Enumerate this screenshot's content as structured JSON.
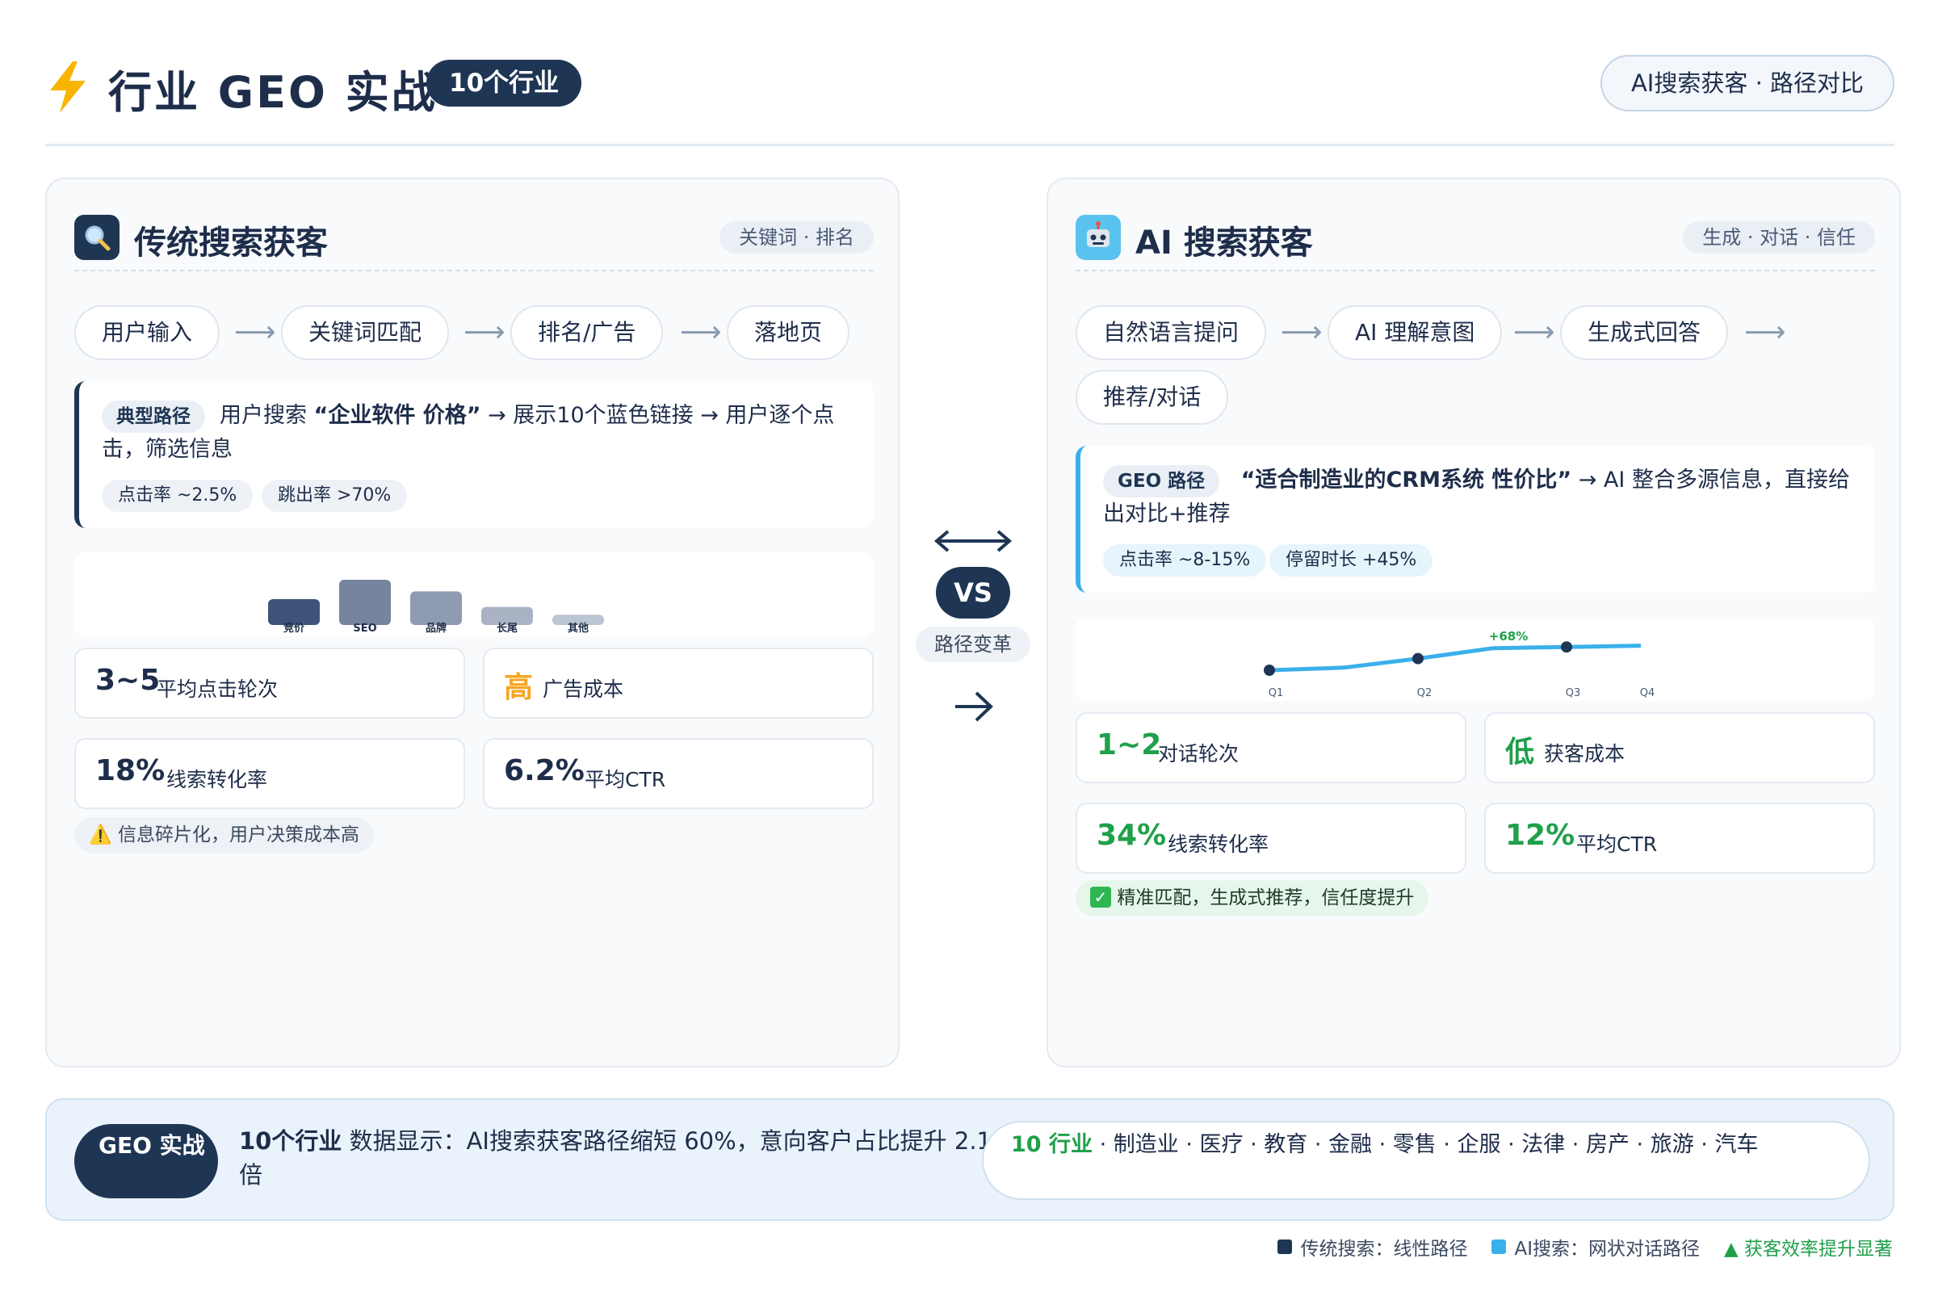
{
  "header": {
    "title": "行业 GEO 实战",
    "badge": "10个行业",
    "subtitle": "AI搜索获客 · 路径对比"
  },
  "colors": {
    "navy": "#1f3554",
    "ai_blue": "#3ab0ea",
    "green": "#1fa04a",
    "orange": "#f5a623"
  },
  "left": {
    "icon": "magnifier-icon",
    "title": "传统搜索获客",
    "tag": "关键词 · 排名",
    "steps": [
      "用户输入",
      "关键词匹配",
      "排名/广告",
      "落地页"
    ],
    "path_label": "典型路径",
    "path_prefix": "用户搜索",
    "path_query": "“企业软件 价格”",
    "path_suffix": "→ 展示10个蓝色链接 → 用户逐个点击，筛选信息",
    "chips": [
      "点击率 ~2.5%",
      "跳出率 >70%"
    ],
    "metrics": [
      {
        "value": "3~5",
        "label": "平均点击轮次"
      },
      {
        "value": "高",
        "label": "广告成本"
      },
      {
        "value": "18%",
        "label": "线索转化率"
      },
      {
        "value": "6.2%",
        "label": "平均CTR"
      }
    ],
    "note_icon": "warning-icon",
    "note": "信息碎片化，用户决策成本高"
  },
  "right": {
    "icon": "robot-icon",
    "title": "AI 搜索获客",
    "tag": "生成 · 对话 · 信任",
    "steps": [
      "自然语言提问",
      "AI 理解意图",
      "生成式回答",
      "推荐/对话"
    ],
    "path_label": "GEO 路径",
    "path_query": "“适合制造业的CRM系统 性价比”",
    "path_suffix": "→ AI 整合多源信息，直接给出对比+推荐",
    "chips": [
      "点击率 ~8-15%",
      "停留时长 +45%"
    ],
    "metrics": [
      {
        "value": "1~2",
        "label": "对话轮次"
      },
      {
        "value": "低",
        "label": "获客成本"
      },
      {
        "value": "34%",
        "label": "线索转化率"
      },
      {
        "value": "12%",
        "label": "平均CTR"
      }
    ],
    "note_icon": "check-icon",
    "note": "精准匹配，生成式推荐，信任度提升"
  },
  "center": {
    "vs": "VS",
    "caption": "路径变革"
  },
  "banner": {
    "badge": "GEO 实战",
    "text_bold": "10个行业",
    "text": " 数据显示：AI搜索获客路径缩短 60%，意向客户占比提升 2.1 倍",
    "industries_hl": "10 行业",
    "industries": "· 制造业 · 医疗 · 教育 · 金融 · 零售 · 企服 · 法律 · 房产 · 旅游 · 汽车"
  },
  "legend": {
    "traditional": "传统搜索：线性路径",
    "ai": "AI搜索：网状对话路径",
    "up": "▲ 获客效率提升显著"
  },
  "chart_data": [
    {
      "type": "bar",
      "categories": [
        "竞价",
        "SEO",
        "品牌",
        "长尾",
        "其他"
      ],
      "values": [
        20,
        35,
        26,
        14,
        8
      ],
      "colors": [
        "#3f5378",
        "#75849f",
        "#8e9bb2",
        "#a9b3c4",
        "#bcc5d2"
      ]
    },
    {
      "type": "line",
      "x": [
        "Q1",
        "",
        "Q2",
        "",
        "Q3",
        "Q4"
      ],
      "values": [
        30,
        34,
        48,
        64,
        66,
        68
      ],
      "markers": [
        0,
        2,
        4
      ],
      "annotation": "+68%",
      "color": "#3ab0ea"
    }
  ]
}
